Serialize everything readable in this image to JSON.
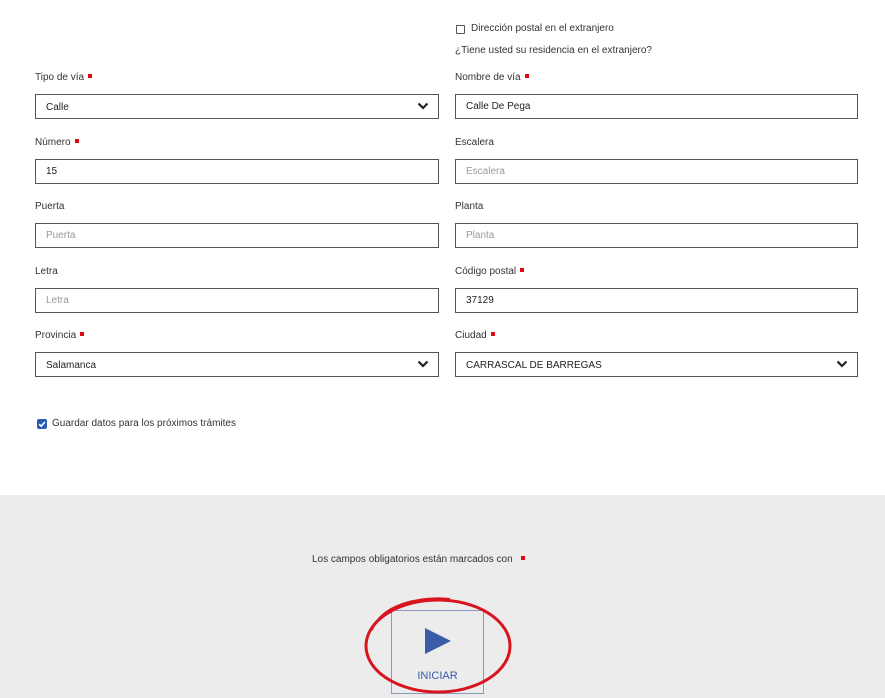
{
  "foreign": {
    "checkbox_label": "Dirección postal en el extranjero",
    "question": "¿Tiene usted su residencia en el extranjero?"
  },
  "fields": {
    "tipo_via": {
      "label": "Tipo de vía",
      "value": "Calle"
    },
    "nombre_via": {
      "label": "Nombre de vía",
      "value": "Calle De Pega"
    },
    "numero": {
      "label": "Número",
      "value": "15"
    },
    "escalera": {
      "label": "Escalera",
      "value": "",
      "placeholder": "Escalera"
    },
    "puerta": {
      "label": "Puerta",
      "value": "",
      "placeholder": "Puerta"
    },
    "planta": {
      "label": "Planta",
      "value": "",
      "placeholder": "Planta"
    },
    "letra": {
      "label": "Letra",
      "value": "",
      "placeholder": "Letra"
    },
    "codigo_postal": {
      "label": "Código postal",
      "value": "37129"
    },
    "provincia": {
      "label": "Provincia",
      "value": "Salamanca"
    },
    "ciudad": {
      "label": "Ciudad",
      "value": "CARRASCAL DE BARREGAS"
    }
  },
  "save_data": {
    "label": "Guardar datos para los próximos trámites",
    "checked": true
  },
  "footer": {
    "required_note": "Los campos obligatorios están marcados con",
    "start_label": "INICIAR"
  },
  "colors": {
    "required_marker": "#e30613",
    "checkbox": "#2a5db0",
    "play_icon": "#3a5ca8",
    "annotation_circle": "#d9141e",
    "footer_bg": "#ececec"
  }
}
